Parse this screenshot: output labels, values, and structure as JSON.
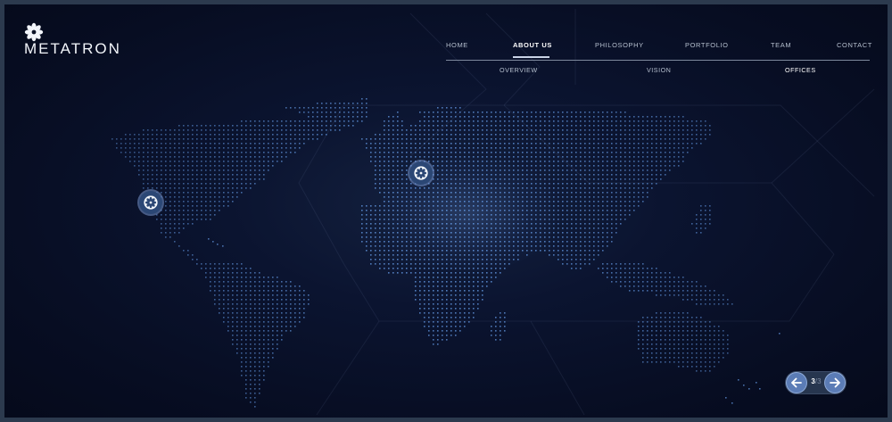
{
  "brand": {
    "name": "METATRON",
    "logo_icon": "flower-emblem-icon"
  },
  "nav": {
    "items": [
      {
        "label": "HOME",
        "active": false
      },
      {
        "label": "ABOUT US",
        "active": true
      },
      {
        "label": "PHILOSOPHY",
        "active": false
      },
      {
        "label": "PORTFOLIO",
        "active": false
      },
      {
        "label": "TEAM",
        "active": false
      },
      {
        "label": "CONTACT",
        "active": false
      }
    ]
  },
  "subnav": {
    "items": [
      {
        "label": "OVERVIEW",
        "active": false
      },
      {
        "label": "VISION",
        "active": false
      },
      {
        "label": "OFFICES",
        "active": true
      }
    ]
  },
  "map": {
    "markers": [
      {
        "name": "office-marker-west-coast",
        "icon": "flower-emblem-icon"
      },
      {
        "name": "office-marker-europe",
        "icon": "flower-emblem-icon"
      }
    ]
  },
  "pager": {
    "current": "3",
    "separator": "/",
    "total": "3",
    "prev_icon": "arrow-left-icon",
    "next_icon": "arrow-right-icon"
  },
  "colors": {
    "background": "#070d22",
    "dot": "#5d8fd6",
    "accent": "#5b7cb6",
    "text": "#ffffff"
  }
}
